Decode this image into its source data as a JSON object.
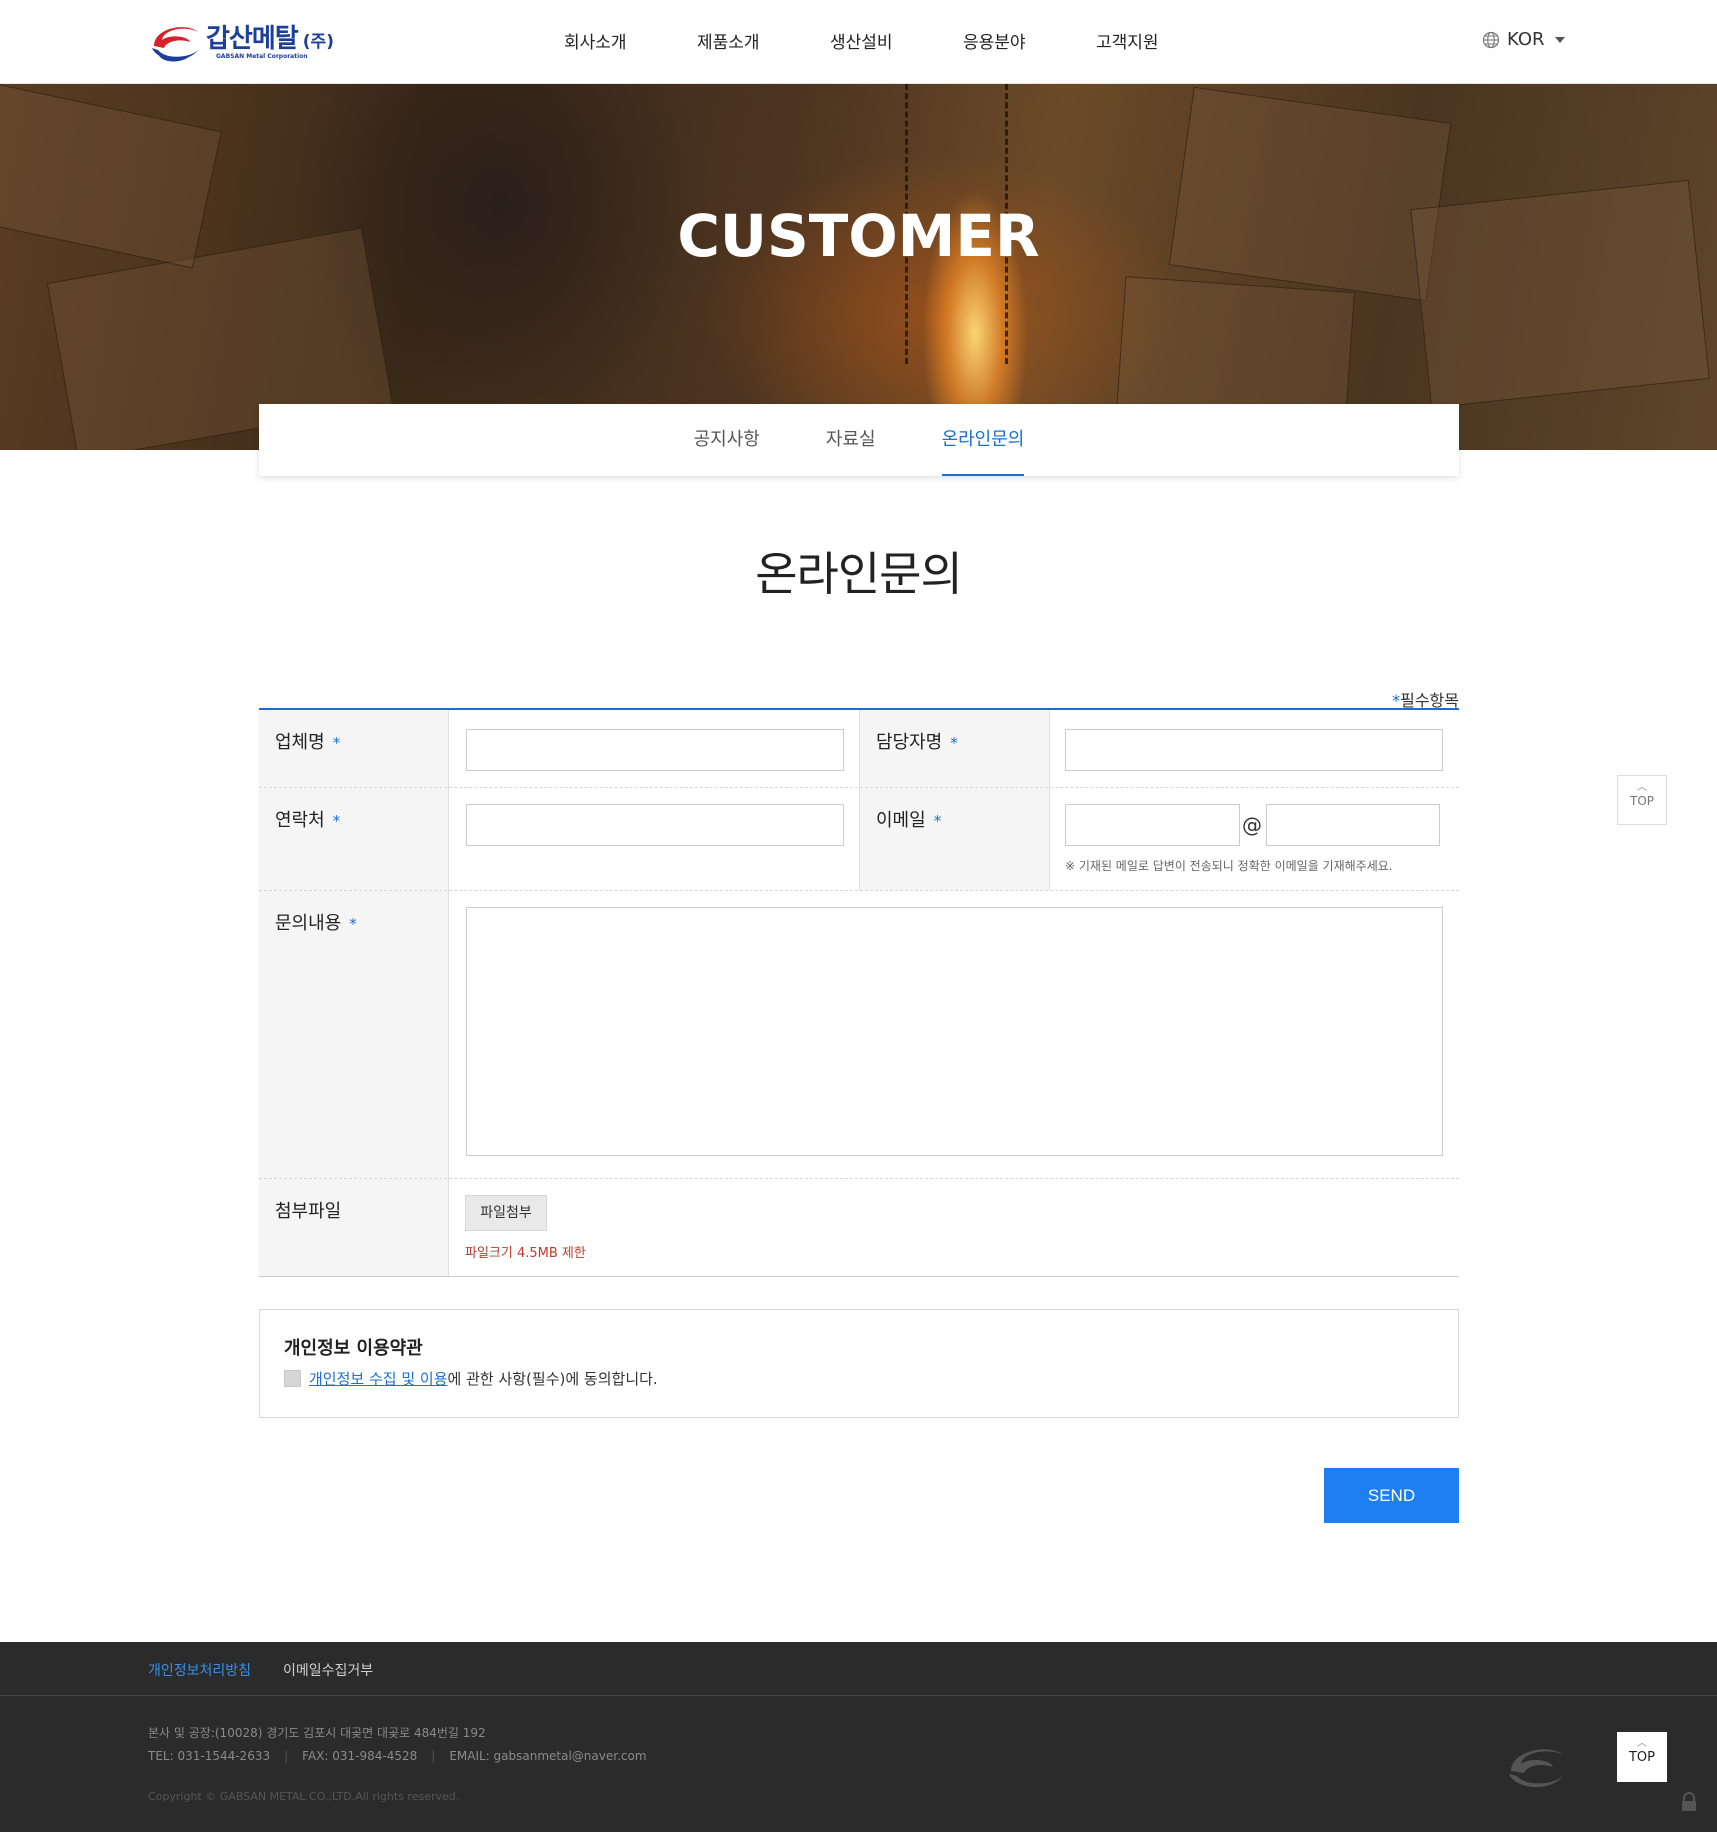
{
  "header": {
    "logo_name": "갑산메탈",
    "logo_corp": "(주)",
    "logo_sub": "GABSAN Metal Corporation",
    "nav": [
      "회사소개",
      "제품소개",
      "생산설비",
      "응용분야",
      "고객지원"
    ],
    "lang": "KOR"
  },
  "hero": {
    "title": "CUSTOMER"
  },
  "subtabs": [
    "공지사항",
    "자료실",
    "온라인문의"
  ],
  "active_subtab": "온라인문의",
  "page_title": "온라인문의",
  "form": {
    "required_star": "*",
    "required_note": "필수항목",
    "company_label": "업체명",
    "manager_label": "담당자명",
    "contact_label": "연락처",
    "email_label": "이메일",
    "email_at": "@",
    "email_note": "※ 기재된 메일로 답변이 전송되니 정확한 이메일을 기재해주세요.",
    "content_label": "문의내용",
    "file_label": "첨부파일",
    "file_button": "파일첨부",
    "file_note": "파일크기 4.5MB 제한",
    "company_value": "",
    "manager_value": "",
    "contact_value": "",
    "email_local_value": "",
    "email_domain_value": "",
    "content_value": ""
  },
  "privacy": {
    "title": "개인정보 이용약관",
    "link_text": "개인정보 수집 및 이용",
    "text_rest": "에 관한 사항(필수)에 동의합니다.",
    "checked": false
  },
  "send_button": "SEND",
  "side_top": {
    "arrow": "︿",
    "label": "TOP"
  },
  "footer": {
    "links": [
      "개인정보처리방침",
      "이메일수집거부"
    ],
    "address": "본사 및 공장:(10028) 경기도 김포시 대곶면 대곶로 484번길 192",
    "tel": "TEL: 031-1544-2633",
    "fax": "FAX: 031-984-4528",
    "email": "EMAIL: gabsanmetal@naver.com",
    "copyright": "Copyright © GABSAN METAL CO.,LTD.All rights reserved.",
    "top_arrow": "︿",
    "top_label": "TOP"
  },
  "colors": {
    "accent": "#1a6fd1",
    "send": "#1e7ff0",
    "footer_bg": "#2b2b2b",
    "file_note": "#c0392b"
  }
}
